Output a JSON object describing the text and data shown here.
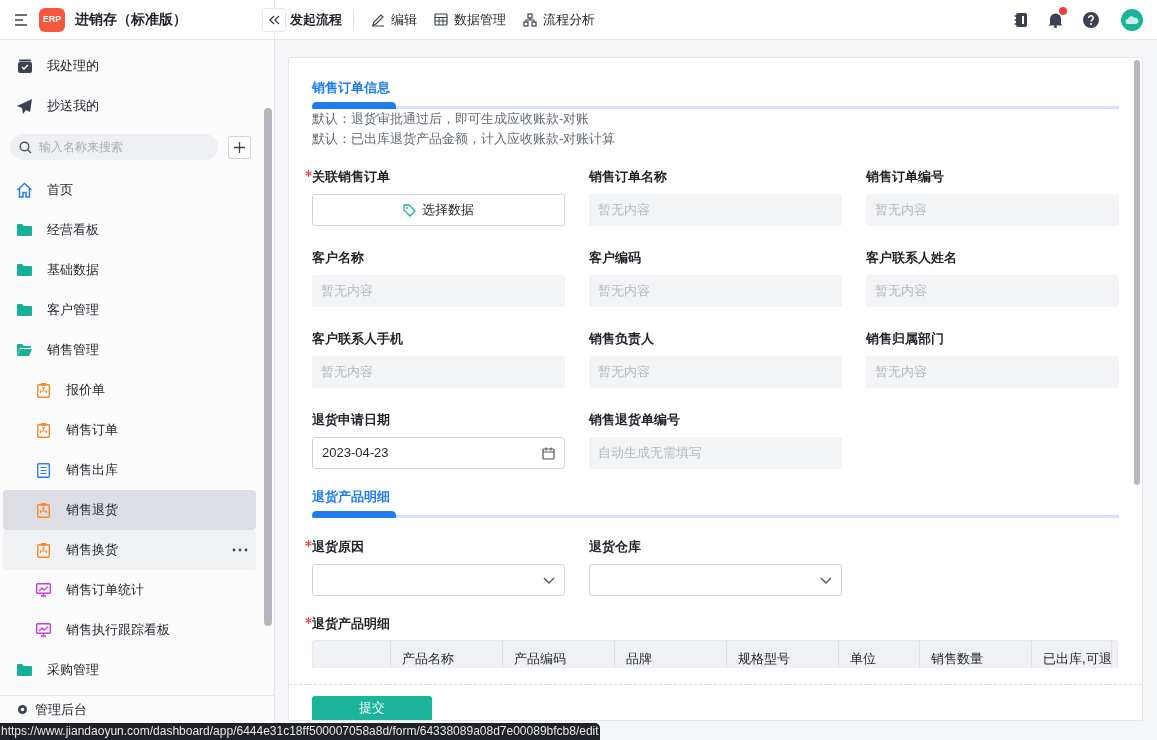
{
  "app": {
    "title": "进销存（标准版）",
    "logo": "ERP"
  },
  "toolbar": [
    {
      "label": "发起流程",
      "kind": "primary"
    },
    {
      "label": "编辑",
      "kind": "edit"
    },
    {
      "label": "数据管理",
      "kind": "grid"
    },
    {
      "label": "流程分析",
      "kind": "flow"
    }
  ],
  "header_icons": [
    {
      "kind": "notebook",
      "badge": false
    },
    {
      "kind": "bell",
      "badge": true
    },
    {
      "kind": "help",
      "badge": false
    }
  ],
  "sidebar": {
    "top_items": [
      {
        "label": "我处理的",
        "kind": "inbox"
      },
      {
        "label": "抄送我的",
        "kind": "send"
      }
    ],
    "search": {
      "placeholder": "输入名称来搜索"
    },
    "items": [
      {
        "label": "首页",
        "kind": "home",
        "selected": false,
        "hovered": false
      },
      {
        "label": "经营看板",
        "kind": "folder",
        "selected": false,
        "hovered": false
      },
      {
        "label": "基础数据",
        "kind": "folder",
        "selected": false,
        "hovered": false
      },
      {
        "label": "客户管理",
        "kind": "folder",
        "selected": false,
        "hovered": false
      },
      {
        "label": "销售管理",
        "kind": "folder-open",
        "selected": false,
        "hovered": false,
        "children": [
          {
            "label": "报价单",
            "kind": "flow-form",
            "selected": false,
            "hovered": false
          },
          {
            "label": "销售订单",
            "kind": "flow-form",
            "selected": false,
            "hovered": false
          },
          {
            "label": "销售出库",
            "kind": "form",
            "selected": false,
            "hovered": false
          },
          {
            "label": "销售退货",
            "kind": "flow-form",
            "selected": true,
            "hovered": false
          },
          {
            "label": "销售换货",
            "kind": "flow-form",
            "selected": false,
            "hovered": true
          },
          {
            "label": "销售订单统计",
            "kind": "dashboard",
            "selected": false,
            "hovered": false
          },
          {
            "label": "销售执行跟踪看板",
            "kind": "dashboard",
            "selected": false,
            "hovered": false
          }
        ]
      },
      {
        "label": "采购管理",
        "kind": "folder",
        "selected": false,
        "hovered": false
      }
    ],
    "footer": "管理后台"
  },
  "form": {
    "sections": [
      {
        "title": "销售订单信息",
        "notes": [
          "默认：退货审批通过后，即可生成应收账款-对账",
          "默认：已出库退货产品金额，计入应收账款-对账计算"
        ],
        "fields": [
          {
            "label": "关联销售订单",
            "required": true,
            "kind": "picker",
            "value": "选择数据"
          },
          {
            "label": "销售订单名称",
            "required": false,
            "kind": "readonly",
            "placeholder": "暂无内容"
          },
          {
            "label": "销售订单编号",
            "required": false,
            "kind": "readonly",
            "placeholder": "暂无内容"
          },
          {
            "label": "客户名称",
            "required": false,
            "kind": "readonly",
            "placeholder": "暂无内容"
          },
          {
            "label": "客户编码",
            "required": false,
            "kind": "readonly",
            "placeholder": "暂无内容"
          },
          {
            "label": "客户联系人姓名",
            "required": false,
            "kind": "readonly",
            "placeholder": "暂无内容"
          },
          {
            "label": "客户联系人手机",
            "required": false,
            "kind": "readonly",
            "placeholder": "暂无内容"
          },
          {
            "label": "销售负责人",
            "required": false,
            "kind": "readonly",
            "placeholder": "暂无内容"
          },
          {
            "label": "销售归属部门",
            "required": false,
            "kind": "readonly",
            "placeholder": "暂无内容"
          },
          {
            "label": "退货申请日期",
            "required": false,
            "kind": "date",
            "value": "2023-04-23"
          },
          {
            "label": "销售退货单编号",
            "required": false,
            "kind": "readonly",
            "placeholder": "自动生成无需填写"
          }
        ]
      },
      {
        "title": "退货产品明细",
        "fields": [
          {
            "label": "退货原因",
            "required": true,
            "kind": "select"
          },
          {
            "label": "退货仓库",
            "required": false,
            "kind": "select"
          }
        ]
      }
    ],
    "subtable": {
      "label": "退货产品明细",
      "required": true,
      "columns": [
        "",
        "产品名称",
        "产品编码",
        "品牌",
        "规格型号",
        "单位",
        "销售数量",
        "已出库,可退"
      ]
    },
    "submit": "提交"
  },
  "status_url": "https://www.jiandaoyun.com/dashboard/app/6444e31c18ff500007058a8d/form/64338089a08d7e00089bfcb8/edit"
}
